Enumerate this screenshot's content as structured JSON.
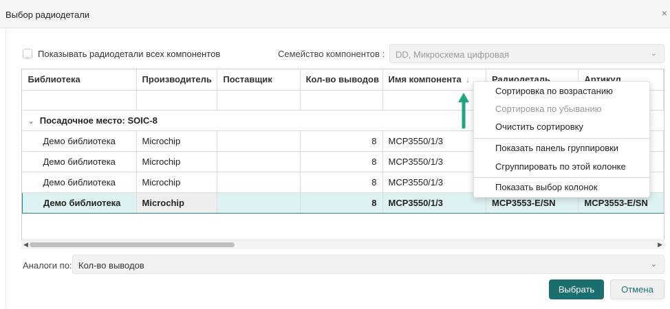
{
  "dialog": {
    "title": "Выбор радиодетали",
    "close": "×"
  },
  "filters": {
    "show_all_label": "Показывать радиодетали всех компонентов",
    "family_label": "Семейство компонентов :",
    "family_value": "DD, Микросхема цифровая"
  },
  "table": {
    "columns": [
      "Библиотека",
      "Производитель",
      "Поставщик",
      "Кол-во выводов",
      "Имя компонента",
      "Радиодеталь",
      "Артикул"
    ],
    "group_label": "Посадочное место: SOIC-8",
    "rows": [
      {
        "library": "Демо библиотека",
        "manufacturer": "Microchip",
        "supplier": "",
        "pins": "8",
        "component": "MCP3550/1/3",
        "part": "",
        "article": ""
      },
      {
        "library": "Демо библиотека",
        "manufacturer": "Microchip",
        "supplier": "",
        "pins": "8",
        "component": "MCP3550/1/3",
        "part": "",
        "article": ""
      },
      {
        "library": "Демо библиотека",
        "manufacturer": "Microchip",
        "supplier": "",
        "pins": "8",
        "component": "MCP3550/1/3",
        "part": "",
        "article": ""
      },
      {
        "library": "Демо библиотека",
        "manufacturer": "Microchip",
        "supplier": "",
        "pins": "8",
        "component": "MCP3550/1/3",
        "part": "MCP3553-E/SN",
        "article": "MCP3553-E/SN"
      }
    ]
  },
  "context_menu": {
    "items": [
      {
        "label": "Сортировка по возрастанию",
        "disabled": false
      },
      {
        "label": "Сортировка по убыванию",
        "disabled": true
      },
      {
        "label": "Очистить сортировку",
        "disabled": false
      },
      {
        "label": "Показать панель группировки",
        "disabled": false
      },
      {
        "label": "Сгруппировать по этой колонке",
        "disabled": false
      },
      {
        "label": "Показать выбор колонок",
        "disabled": false
      }
    ]
  },
  "analogs": {
    "label": "Аналоги по:",
    "value": "Кол-во выводов"
  },
  "buttons": {
    "select": "Выбрать",
    "cancel": "Отмена"
  },
  "colors": {
    "accent": "#1c6f6f",
    "selection_bg": "#dff2f3",
    "selection_border": "#1f8a91",
    "annotation_arrow": "#1ea67f"
  },
  "icons": {
    "sort": "arrow-down-icon",
    "group_toggle": "chevron-down-icon",
    "select_chevron": "chevron-down-icon",
    "close": "close-icon",
    "annotation": "up-arrow-icon"
  }
}
